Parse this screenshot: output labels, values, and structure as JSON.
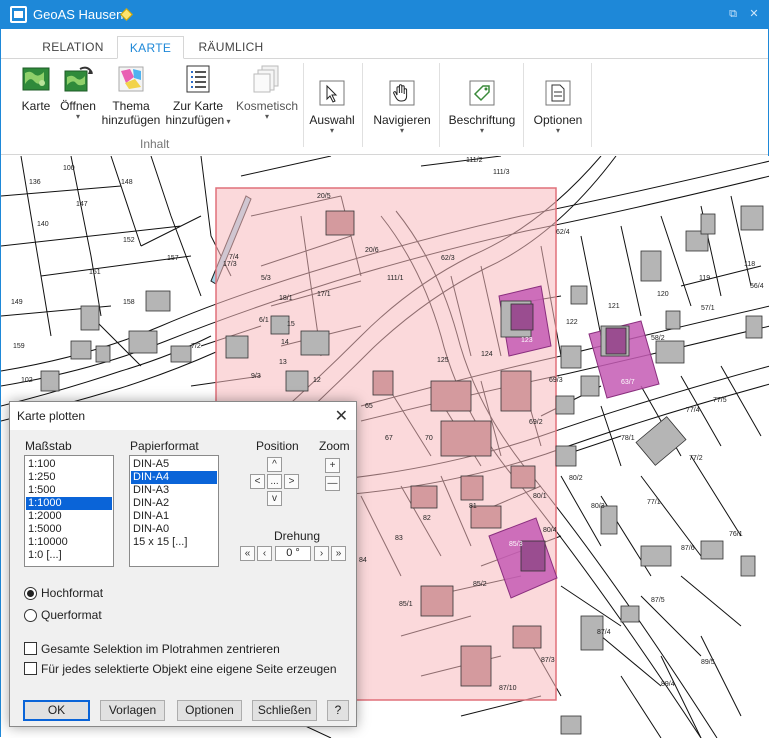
{
  "app": {
    "title": "GeoAS Hausen"
  },
  "window_buttons": {
    "restore": "⧉",
    "close": "✕"
  },
  "tabs": [
    {
      "label": "RELATION",
      "active": false
    },
    {
      "label": "KARTE",
      "active": true
    },
    {
      "label": "RÄUMLICH",
      "active": false
    }
  ],
  "ribbon": {
    "karte": "Karte",
    "oeffnen": "Öffnen",
    "thema_1": "Thema",
    "thema_2": "hinzufügen",
    "zur_karte_1": "Zur Karte",
    "zur_karte_2": "hinzufügen",
    "kosmetisch": "Kosmetisch",
    "inhalt_group": "Inhalt",
    "auswahl": "Auswahl",
    "navigieren": "Navigieren",
    "beschriftung": "Beschriftung",
    "optionen": "Optionen",
    "caret": "▾"
  },
  "map": {
    "parcel_labels": [
      {
        "t": "136"
      },
      {
        "t": "100"
      },
      {
        "t": "148"
      },
      {
        "t": "147"
      },
      {
        "t": "140"
      },
      {
        "t": "152"
      },
      {
        "t": "157"
      },
      {
        "t": "151"
      },
      {
        "t": "149"
      },
      {
        "t": "158"
      },
      {
        "t": "159"
      },
      {
        "t": "102"
      },
      {
        "t": "7/4"
      },
      {
        "t": "7/2"
      },
      {
        "t": "20/5"
      },
      {
        "t": "20/6"
      },
      {
        "t": "17/3"
      },
      {
        "t": "5/3"
      },
      {
        "t": "18/1"
      },
      {
        "t": "17/1"
      },
      {
        "t": "6/1"
      },
      {
        "t": "15"
      },
      {
        "t": "14"
      },
      {
        "t": "13"
      },
      {
        "t": "12"
      },
      {
        "t": "9/3"
      },
      {
        "t": "111/1"
      },
      {
        "t": "62/3"
      },
      {
        "t": "111/2"
      },
      {
        "t": "111/3"
      },
      {
        "t": "62/4"
      },
      {
        "t": "125"
      },
      {
        "t": "124"
      },
      {
        "t": "123"
      },
      {
        "t": "122"
      },
      {
        "t": "121"
      },
      {
        "t": "120"
      },
      {
        "t": "119"
      },
      {
        "t": "118"
      },
      {
        "t": "56/4"
      },
      {
        "t": "57/1"
      },
      {
        "t": "58/2"
      },
      {
        "t": "63/7"
      },
      {
        "t": "69/3"
      },
      {
        "t": "69/2"
      },
      {
        "t": "65"
      },
      {
        "t": "67"
      },
      {
        "t": "70"
      },
      {
        "t": "77/4"
      },
      {
        "t": "77/5"
      },
      {
        "t": "78/1"
      },
      {
        "t": "77/2"
      },
      {
        "t": "80/2"
      },
      {
        "t": "80/1"
      },
      {
        "t": "80/3"
      },
      {
        "t": "77/1"
      },
      {
        "t": "81"
      },
      {
        "t": "82"
      },
      {
        "t": "83"
      },
      {
        "t": "84"
      },
      {
        "t": "85/3"
      },
      {
        "t": "80/4"
      },
      {
        "t": "85/2"
      },
      {
        "t": "85/1"
      },
      {
        "t": "76/1"
      },
      {
        "t": "87/6"
      },
      {
        "t": "87/5"
      },
      {
        "t": "87/4"
      },
      {
        "t": "89/5"
      },
      {
        "t": "89/4"
      },
      {
        "t": "87/3"
      },
      {
        "t": "87/10"
      }
    ]
  },
  "dialog": {
    "title": "Karte plotten",
    "close": "✕",
    "massstab_label": "Maßstab",
    "massstab_items": [
      "1:100",
      "1:250",
      "1:500",
      "1:1000",
      "1:2000",
      "1:5000",
      "1:10000",
      "1:0 [...]"
    ],
    "massstab_selected": "1:1000",
    "papier_label": "Papierformat",
    "papier_items": [
      "DIN-A5",
      "DIN-A4",
      "DIN-A3",
      "DIN-A2",
      "DIN-A1",
      "DIN-A0",
      "15 x 15 [...]"
    ],
    "papier_selected": "DIN-A4",
    "position_label": "Position",
    "zoom_label": "Zoom",
    "pos_up": "^",
    "pos_left": "<",
    "pos_center": "...",
    "pos_right": ">",
    "pos_down": "v",
    "zoom_in": "+",
    "zoom_out": "—",
    "drehung_label": "Drehung",
    "rot_first": "«",
    "rot_prev": "‹",
    "rot_value": "0 °",
    "rot_next": "›",
    "rot_last": "»",
    "orientation": [
      {
        "label": "Hochformat",
        "checked": true
      },
      {
        "label": "Querformat",
        "checked": false
      }
    ],
    "check_center": "Gesamte Selektion im Plotrahmen zentrieren",
    "check_pages": "Für jedes selektierte Objekt eine eigene Seite erzeugen",
    "buttons": {
      "ok": "OK",
      "vorlagen": "Vorlagen",
      "optionen": "Optionen",
      "schliessen": "Schließen",
      "help": "?"
    }
  },
  "colors": {
    "accent": "#1e88d8",
    "plot_frame_fill": "#f7b9bd",
    "plot_frame_stroke": "#e0707a",
    "selection_fill": "#c45bb4",
    "building_fill": "#b5b5b5"
  }
}
